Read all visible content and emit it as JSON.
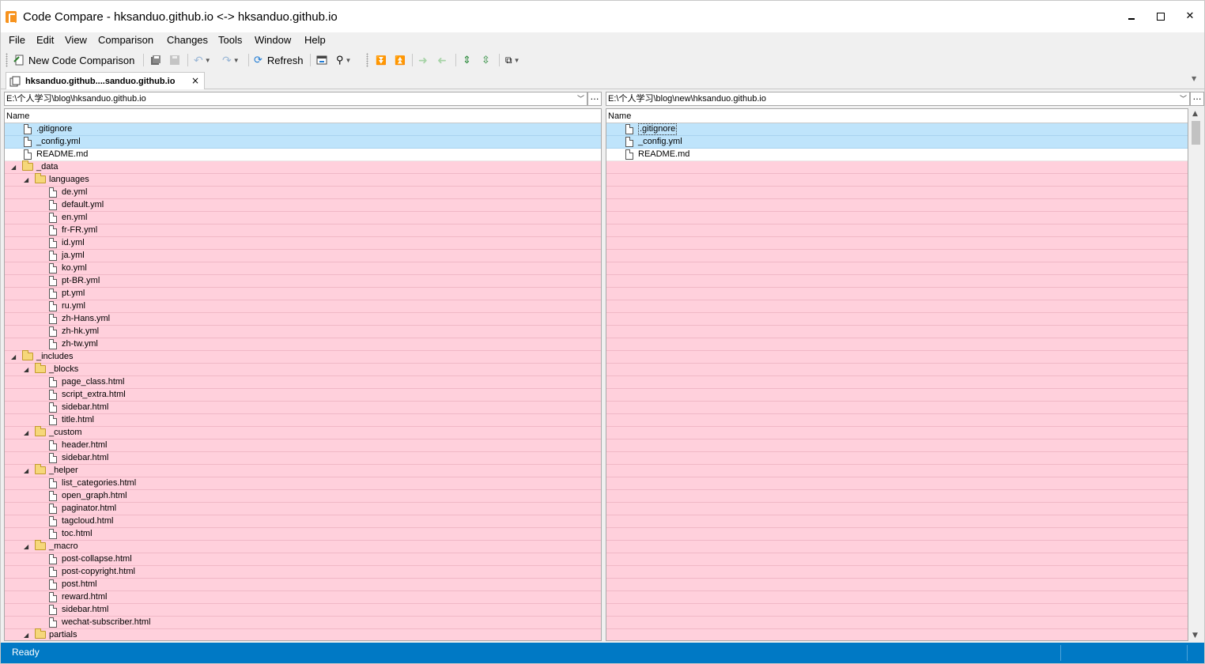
{
  "window": {
    "title": "Code Compare - hksanduo.github.io <-> hksanduo.github.io"
  },
  "menu": [
    "File",
    "Edit",
    "View",
    "Comparison",
    "Changes",
    "Tools",
    "Window",
    "Help"
  ],
  "toolbar": {
    "new_comparison": "New Code Comparison",
    "refresh": "Refresh"
  },
  "tab": {
    "label": "hksanduo.github....sanduo.github.io",
    "close": "×"
  },
  "left": {
    "path": "E:\\个人学习\\blog\\hksanduo.github.io",
    "column": "Name",
    "rows": [
      {
        "name": ".gitignore",
        "type": "file",
        "level": 1,
        "state": "blue"
      },
      {
        "name": "_config.yml",
        "type": "file",
        "level": 1,
        "state": "blue"
      },
      {
        "name": "README.md",
        "type": "file",
        "level": 1,
        "state": "white"
      },
      {
        "name": "_data",
        "type": "folder",
        "level": 0,
        "state": "pink"
      },
      {
        "name": "languages",
        "type": "folder",
        "level": 1,
        "state": "pink"
      },
      {
        "name": "de.yml",
        "type": "file",
        "level": 3,
        "state": "pink"
      },
      {
        "name": "default.yml",
        "type": "file",
        "level": 3,
        "state": "pink"
      },
      {
        "name": "en.yml",
        "type": "file",
        "level": 3,
        "state": "pink"
      },
      {
        "name": "fr-FR.yml",
        "type": "file",
        "level": 3,
        "state": "pink"
      },
      {
        "name": "id.yml",
        "type": "file",
        "level": 3,
        "state": "pink"
      },
      {
        "name": "ja.yml",
        "type": "file",
        "level": 3,
        "state": "pink"
      },
      {
        "name": "ko.yml",
        "type": "file",
        "level": 3,
        "state": "pink"
      },
      {
        "name": "pt-BR.yml",
        "type": "file",
        "level": 3,
        "state": "pink"
      },
      {
        "name": "pt.yml",
        "type": "file",
        "level": 3,
        "state": "pink"
      },
      {
        "name": "ru.yml",
        "type": "file",
        "level": 3,
        "state": "pink"
      },
      {
        "name": "zh-Hans.yml",
        "type": "file",
        "level": 3,
        "state": "pink"
      },
      {
        "name": "zh-hk.yml",
        "type": "file",
        "level": 3,
        "state": "pink"
      },
      {
        "name": "zh-tw.yml",
        "type": "file",
        "level": 3,
        "state": "pink"
      },
      {
        "name": "_includes",
        "type": "folder",
        "level": 0,
        "state": "pink"
      },
      {
        "name": "_blocks",
        "type": "folder",
        "level": 1,
        "state": "pink"
      },
      {
        "name": "page_class.html",
        "type": "file",
        "level": 3,
        "state": "pink"
      },
      {
        "name": "script_extra.html",
        "type": "file",
        "level": 3,
        "state": "pink"
      },
      {
        "name": "sidebar.html",
        "type": "file",
        "level": 3,
        "state": "pink"
      },
      {
        "name": "title.html",
        "type": "file",
        "level": 3,
        "state": "pink"
      },
      {
        "name": "_custom",
        "type": "folder",
        "level": 1,
        "state": "pink"
      },
      {
        "name": "header.html",
        "type": "file",
        "level": 3,
        "state": "pink"
      },
      {
        "name": "sidebar.html",
        "type": "file",
        "level": 3,
        "state": "pink"
      },
      {
        "name": "_helper",
        "type": "folder",
        "level": 1,
        "state": "pink"
      },
      {
        "name": "list_categories.html",
        "type": "file",
        "level": 3,
        "state": "pink"
      },
      {
        "name": "open_graph.html",
        "type": "file",
        "level": 3,
        "state": "pink"
      },
      {
        "name": "paginator.html",
        "type": "file",
        "level": 3,
        "state": "pink"
      },
      {
        "name": "tagcloud.html",
        "type": "file",
        "level": 3,
        "state": "pink"
      },
      {
        "name": "toc.html",
        "type": "file",
        "level": 3,
        "state": "pink"
      },
      {
        "name": "_macro",
        "type": "folder",
        "level": 1,
        "state": "pink"
      },
      {
        "name": "post-collapse.html",
        "type": "file",
        "level": 3,
        "state": "pink"
      },
      {
        "name": "post-copyright.html",
        "type": "file",
        "level": 3,
        "state": "pink"
      },
      {
        "name": "post.html",
        "type": "file",
        "level": 3,
        "state": "pink"
      },
      {
        "name": "reward.html",
        "type": "file",
        "level": 3,
        "state": "pink"
      },
      {
        "name": "sidebar.html",
        "type": "file",
        "level": 3,
        "state": "pink"
      },
      {
        "name": "wechat-subscriber.html",
        "type": "file",
        "level": 3,
        "state": "pink"
      },
      {
        "name": "partials",
        "type": "folder",
        "level": 1,
        "state": "pink"
      }
    ]
  },
  "right": {
    "path": "E:\\个人学习\\blog\\new\\hksanduo.github.io",
    "column": "Name",
    "rows": [
      {
        "name": ".gitignore",
        "type": "file",
        "level": 1,
        "state": "blue",
        "focus": true
      },
      {
        "name": "_config.yml",
        "type": "file",
        "level": 1,
        "state": "blue"
      },
      {
        "name": "README.md",
        "type": "file",
        "level": 1,
        "state": "white"
      }
    ]
  },
  "status": {
    "text": "Ready"
  }
}
